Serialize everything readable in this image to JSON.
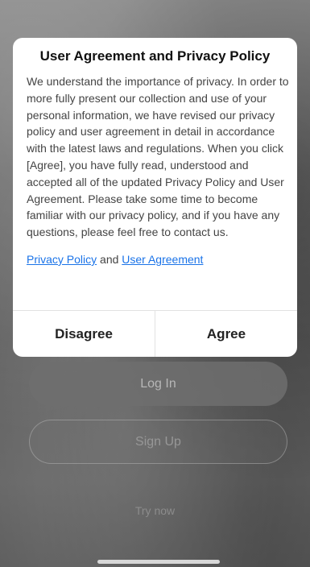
{
  "background": {
    "login_label": "Log In",
    "signup_label": "Sign Up",
    "try_now_label": "Try now"
  },
  "dialog": {
    "title": "User Agreement and Privacy Policy",
    "body": "We understand the importance of privacy. In order to more fully present our collection and use of your personal information, we have revised our privacy policy and user agreement in detail in accordance with the latest laws and regulations. When you click [Agree], you have fully read, understood and accepted all of the updated Privacy Policy and User Agreement. Please take some time to become familiar with our privacy policy, and if you have any questions, please feel free to contact us.",
    "privacy_link": "Privacy Policy",
    "link_joiner": "and",
    "agreement_link": "User Agreement",
    "disagree_label": "Disagree",
    "agree_label": "Agree"
  },
  "colors": {
    "link": "#1a73e8",
    "dialog_bg": "#ffffff",
    "overlay": "#6f6f6f"
  }
}
